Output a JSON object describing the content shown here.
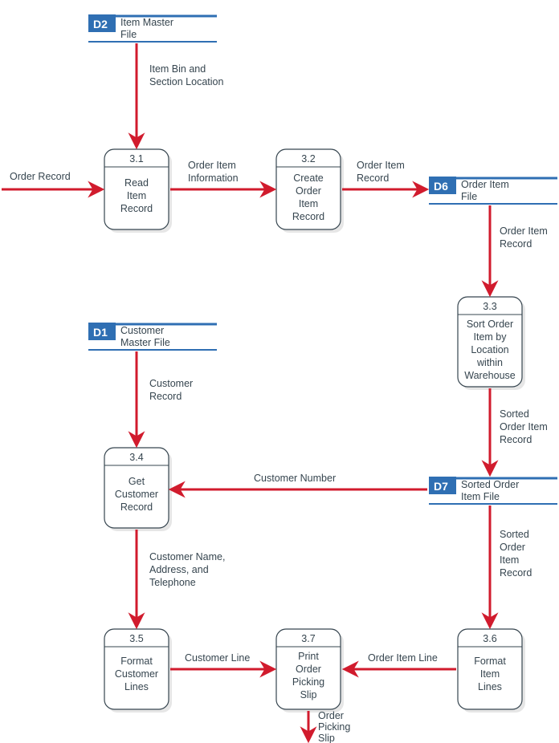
{
  "processes": {
    "p31": {
      "num": "3.1",
      "label": [
        "Read",
        "Item",
        "Record"
      ]
    },
    "p32": {
      "num": "3.2",
      "label": [
        "Create",
        "Order",
        "Item",
        "Record"
      ]
    },
    "p33": {
      "num": "3.3",
      "label": [
        "Sort Order",
        "Item by",
        "Location",
        "within",
        "Warehouse"
      ]
    },
    "p34": {
      "num": "3.4",
      "label": [
        "Get",
        "Customer",
        "Record"
      ]
    },
    "p35": {
      "num": "3.5",
      "label": [
        "Format",
        "Customer",
        "Lines"
      ]
    },
    "p36": {
      "num": "3.6",
      "label": [
        "Format",
        "Item",
        "Lines"
      ]
    },
    "p37": {
      "num": "3.7",
      "label": [
        "Print",
        "Order",
        "Picking",
        "Slip"
      ]
    }
  },
  "datastores": {
    "d2": {
      "id": "D2",
      "name": [
        "Item Master",
        "File"
      ]
    },
    "d6": {
      "id": "D6",
      "name": [
        "Order Item",
        "File"
      ]
    },
    "d1": {
      "id": "D1",
      "name": [
        "Customer",
        "Master File"
      ]
    },
    "d7": {
      "id": "D7",
      "name": [
        "Sorted Order",
        "Item File"
      ]
    }
  },
  "flows": {
    "orderRecord": "Order Record",
    "itemBin": [
      "Item Bin and",
      "Section Location"
    ],
    "orderItemInfo": [
      "Order Item",
      "Information"
    ],
    "orderItemRec": [
      "Order Item",
      "Record"
    ],
    "orderItemRec2": [
      "Order Item",
      "Record"
    ],
    "sortedOIR": [
      "Sorted",
      "Order Item",
      "Record"
    ],
    "custRec": [
      "Customer",
      "Record"
    ],
    "custNum": "Customer Number",
    "custNAT": [
      "Customer Name,",
      "Address, and",
      "Telephone"
    ],
    "sortedOIR2": [
      "Sorted",
      "Order",
      "Item",
      "Record"
    ],
    "custLine": "Customer Line",
    "orderItemLine": "Order Item Line",
    "orderPickSlip": [
      "Order",
      "Picking",
      "Slip"
    ]
  }
}
